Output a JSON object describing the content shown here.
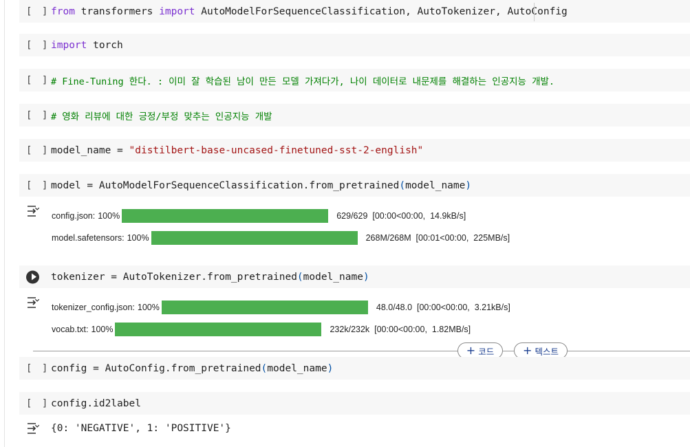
{
  "cells": [
    {
      "bracket": "[ ]",
      "code": {
        "kw1": "from",
        "mid1": " transformers ",
        "kw2": "import",
        "rest": " AutoModelForSequenceClassification, AutoTokenizer, AutoConfig"
      }
    },
    {
      "bracket": "[ ]",
      "code": {
        "kw1": "import",
        "rest": " torch"
      }
    },
    {
      "bracket": "[ ]",
      "comment": "# Fine-Tuning 한다. : 이미 잘 학습된 남이 만든 모델 가져다가, 나이 데이터로 내문제를 해결하는 인공지능 개발."
    },
    {
      "bracket": "[ ]",
      "comment": "# 영화 리뷰에 대한 긍정/부정 맞추는 인공지능 개발"
    },
    {
      "bracket": "[ ]",
      "code": {
        "pre": "model_name = ",
        "str": "\"distilbert-base-uncased-finetuned-sst-2-english\""
      }
    },
    {
      "bracket": "[ ]",
      "code": {
        "pre": "model = AutoModelForSequenceClassification.from_pretrained",
        "lp": "(",
        "arg": "model_name",
        "rp": ")"
      },
      "outputs": [
        {
          "label": "config.json:",
          "pct": "100%",
          "progress": 1.0,
          "stats": "629/629  [00:00<00:00,  14.9kB/s]"
        },
        {
          "label": "model.safetensors:",
          "pct": "100%",
          "progress": 1.0,
          "stats": "268M/268M  [00:01<00:00,  225MB/s]"
        }
      ]
    },
    {
      "running": true,
      "code": {
        "pre": "tokenizer = AutoTokenizer.from_pretrained",
        "lp": "(",
        "arg": "model_name",
        "rp": ")"
      },
      "outputs": [
        {
          "label": "tokenizer_config.json:",
          "pct": "100%",
          "progress": 1.0,
          "stats": "48.0/48.0  [00:00<00:00,  3.21kB/s]"
        },
        {
          "label": "vocab.txt:",
          "pct": "100%",
          "progress": 1.0,
          "stats": "232k/232k  [00:00<00:00,  1.82MB/s]"
        }
      ]
    },
    {
      "bracket": "[ ]",
      "code": {
        "pre": "config = AutoConfig.from_pretrained",
        "lp": "(",
        "arg": "model_name",
        "rp": ")"
      }
    },
    {
      "bracket": "[ ]",
      "code": {
        "pre": "config.id2label"
      },
      "result": "{0: 'NEGATIVE', 1: 'POSITIVE'}"
    }
  ],
  "toolbar": {
    "add_code": "코드",
    "add_text": "텍스트"
  },
  "icons": {
    "output": "output-toggle-icon",
    "run": "run-cell-icon",
    "plus": "plus-icon"
  },
  "colors": {
    "progress": "#4caf50",
    "keyword": "#7b30d0",
    "string": "#a31515",
    "comment": "#008000"
  }
}
